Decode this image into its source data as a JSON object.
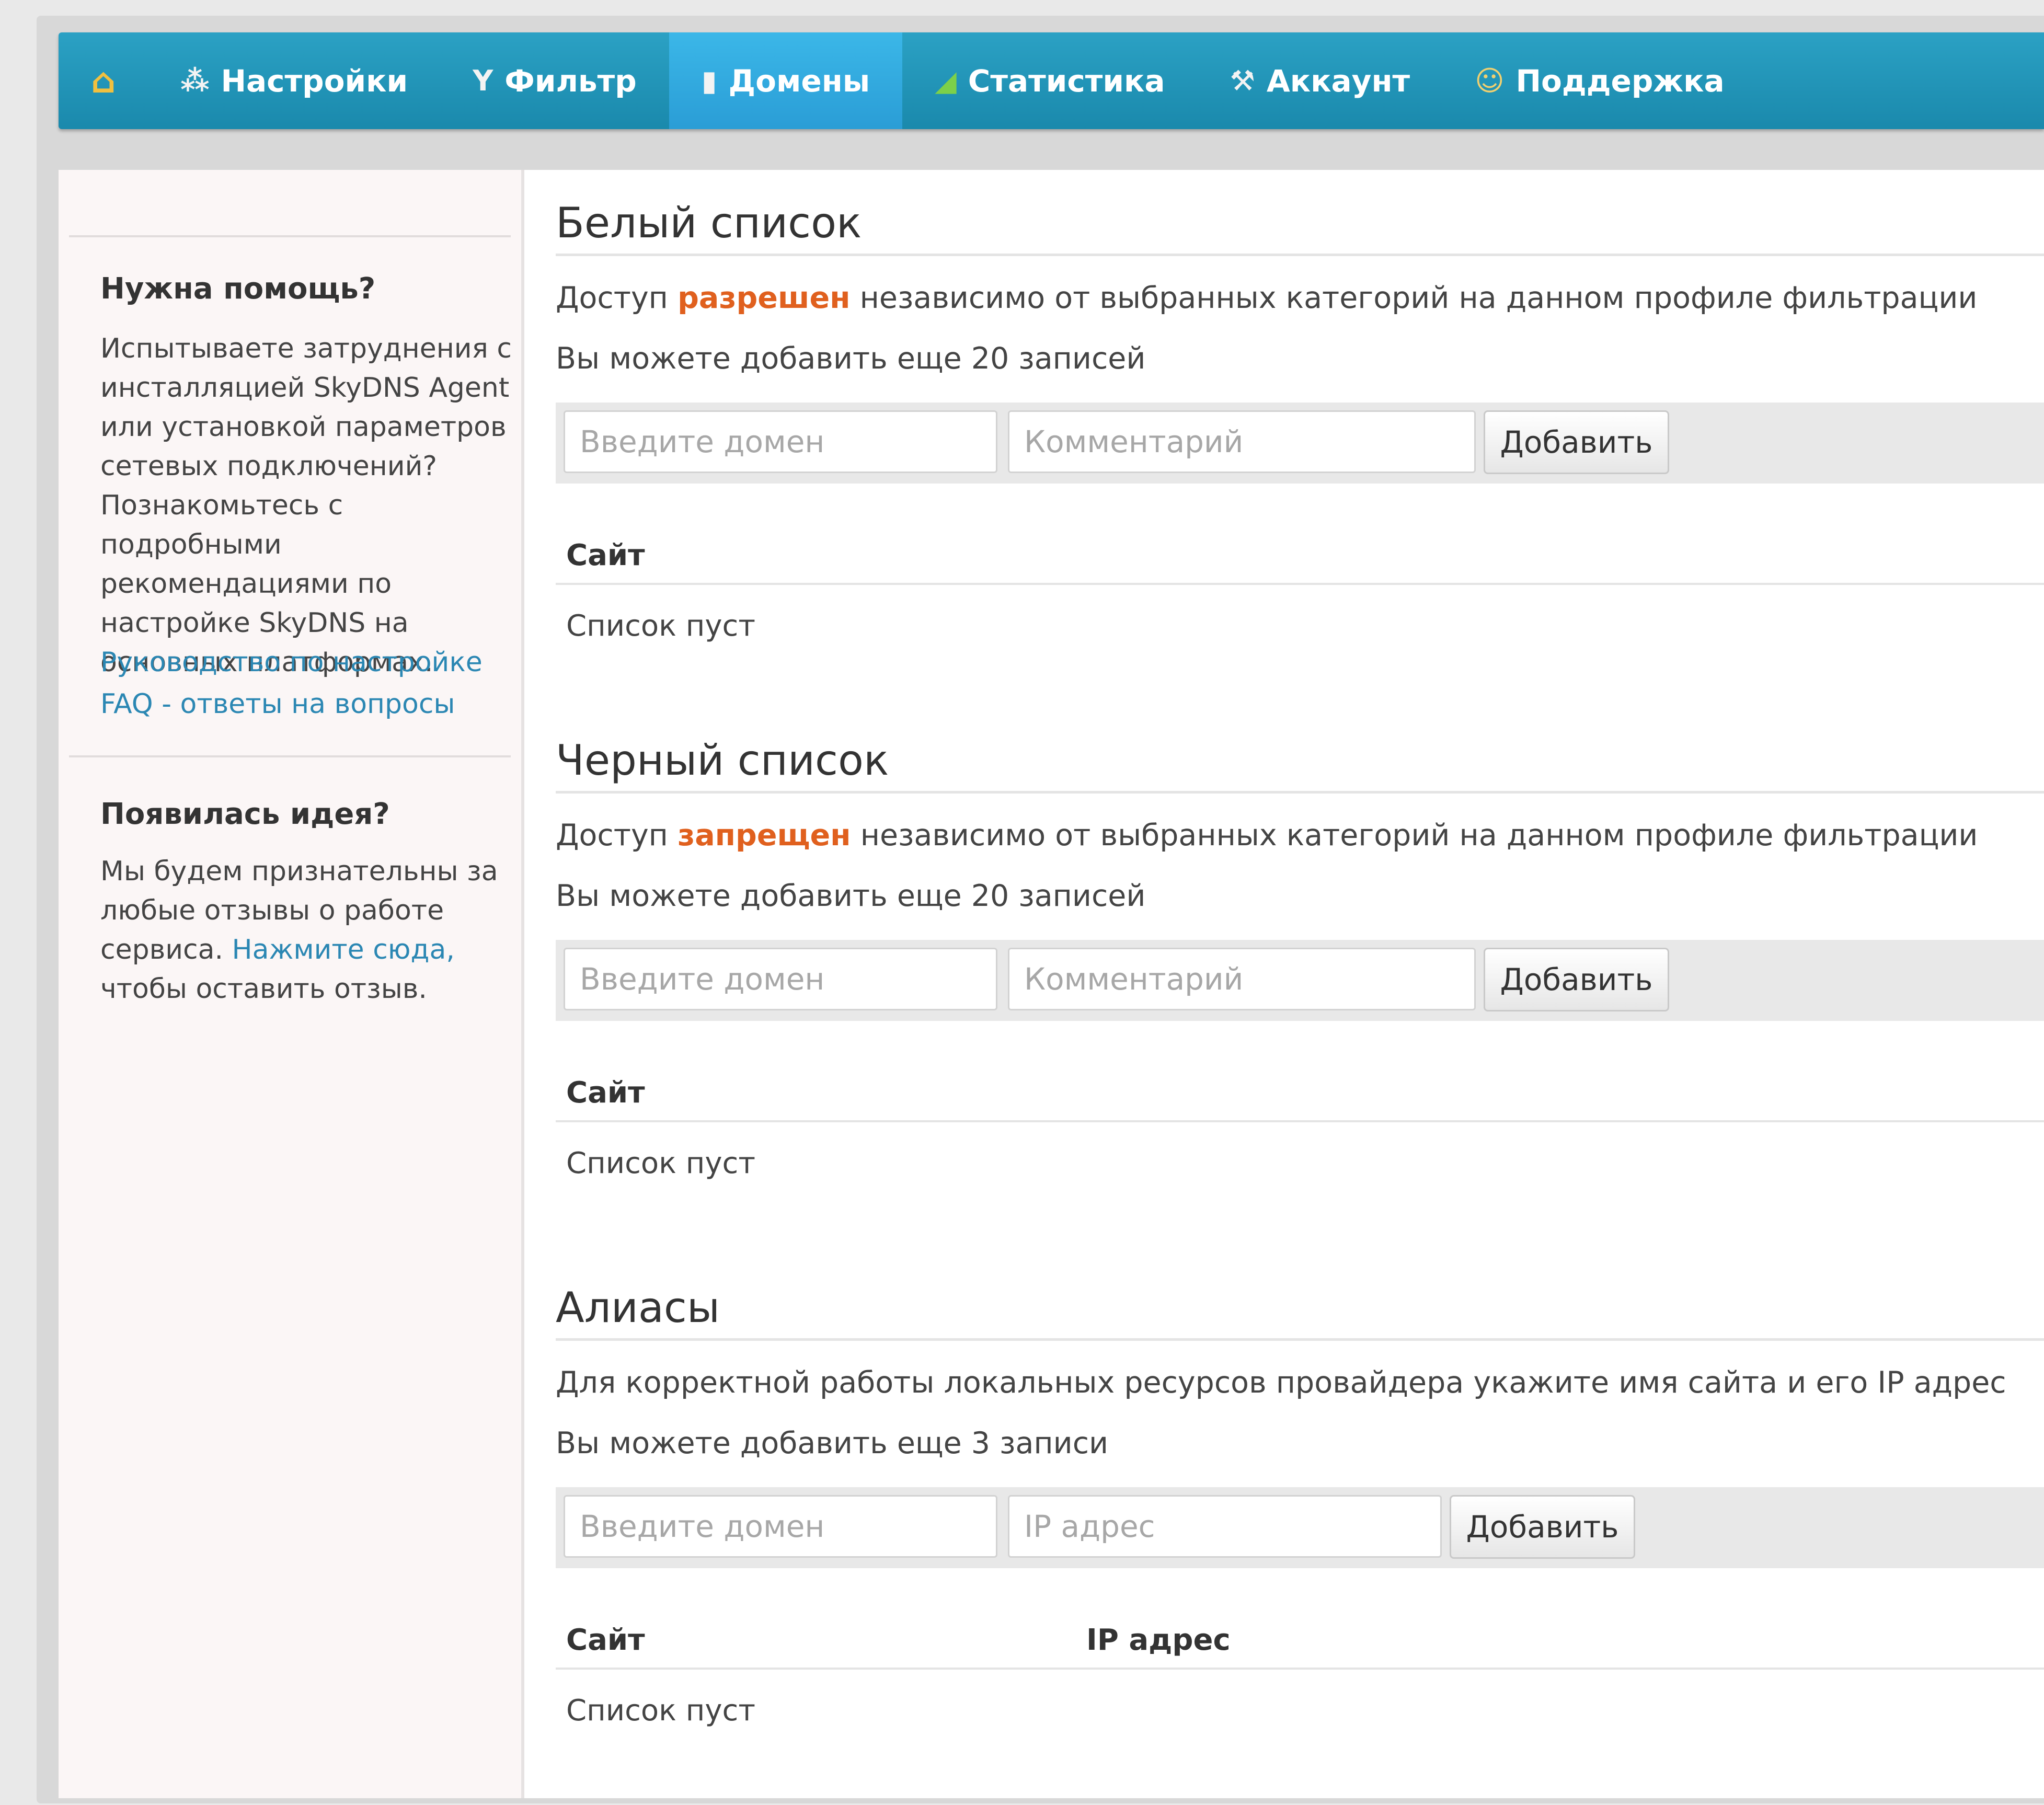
{
  "nav": {
    "home_icon": "home-icon",
    "items": [
      {
        "label": "Настройки",
        "icon": "network-icon"
      },
      {
        "label": "Фильтр",
        "icon": "filter-icon"
      },
      {
        "label": "Домены",
        "icon": "document-icon",
        "active": true
      },
      {
        "label": "Статистика",
        "icon": "chart-icon"
      },
      {
        "label": "Аккаунт",
        "icon": "wrench-icon"
      },
      {
        "label": "Поддержка",
        "icon": "user-icon"
      }
    ]
  },
  "sidebar": {
    "help_title": "Нужна помощь?",
    "help_text": "Испытываете затруднения с инсталляцией SkyDNS Agent или установкой параметров сетевых подключений? Познакомьтесь с подробными рекомендациями по настройке SkyDNS на основных платформах.",
    "guide_link": "Руководство по настройке",
    "faq_link": "FAQ - ответы на вопросы",
    "idea_title": "Появилась идея?",
    "idea_text_1": "Мы будем признательны за любые отзывы о работе сервиса.",
    "idea_link": "Нажмите сюда,",
    "idea_text_2": "чтобы оставить отзыв."
  },
  "whitelist": {
    "title": "Белый список",
    "desc_prefix": "Доступ",
    "desc_highlight": "разрешен",
    "desc_suffix": "независимо от выбранных категорий на данном профиле фильтрации",
    "remaining": "Вы можете добавить еще 20 записей",
    "domain_placeholder": "Введите домен",
    "comment_placeholder": "Комментарий",
    "add_label": "Добавить",
    "col_site": "Сайт",
    "empty": "Список пуст"
  },
  "blacklist": {
    "title": "Черный список",
    "desc_prefix": "Доступ",
    "desc_highlight": "запрещен",
    "desc_suffix": "независимо от выбранных категорий на данном профиле фильтрации",
    "remaining": "Вы можете добавить еще 20 записей",
    "domain_placeholder": "Введите домен",
    "comment_placeholder": "Комментарий",
    "add_label": "Добавить",
    "col_site": "Сайт",
    "empty": "Список пуст"
  },
  "aliases": {
    "title": "Алиасы",
    "desc": "Для корректной работы локальных ресурсов провайдера укажите имя сайта и его IP адрес",
    "remaining": "Вы можете добавить еще 3 записи",
    "domain_placeholder": "Введите домен",
    "ip_placeholder": "IP адрес",
    "add_label": "Добавить",
    "col_site": "Сайт",
    "col_ip": "IP адрес",
    "empty": "Список пуст"
  },
  "colors": {
    "nav": "#1e92b6",
    "nav_active": "#36b0e2",
    "highlight": "#e0601e",
    "link": "#2b87b3"
  }
}
